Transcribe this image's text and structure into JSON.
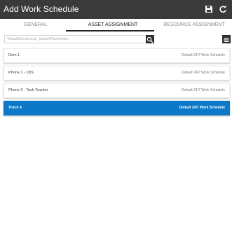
{
  "app": {
    "title": "Add Work Schedule",
    "icons": {
      "save": "save-icon",
      "refresh": "refresh-icon"
    }
  },
  "tabs": [
    {
      "label": "GENERAL",
      "active": false
    },
    {
      "label": "ASSET ASSIGNMENT",
      "active": true
    },
    {
      "label": "RESOURCE ASSIGNMENT",
      "active": false
    }
  ],
  "search": {
    "placeholder": "VirtualSelectionList_SearchPlaceholder",
    "value": ""
  },
  "toolbar_icons": {
    "search": "search-icon",
    "menu": "hamburger-menu-icon"
  },
  "assets": [
    {
      "name": "Dom 1",
      "schedule": "Default 24/7 Work Schedule",
      "selected": false
    },
    {
      "name": "Phone 1 - LBS",
      "schedule": "Default 24/7 Work Schedule",
      "selected": false
    },
    {
      "name": "Phone 2 - Task Tracker",
      "schedule": "Default 24/7 Work Schedule",
      "selected": false
    },
    {
      "name": "Track 4",
      "schedule": "Default 24/7 Work Schedule",
      "selected": true
    }
  ],
  "colors": {
    "titlebar": "#3a3a3a",
    "selection": "#0b78c8",
    "active_tab": "#222222"
  }
}
